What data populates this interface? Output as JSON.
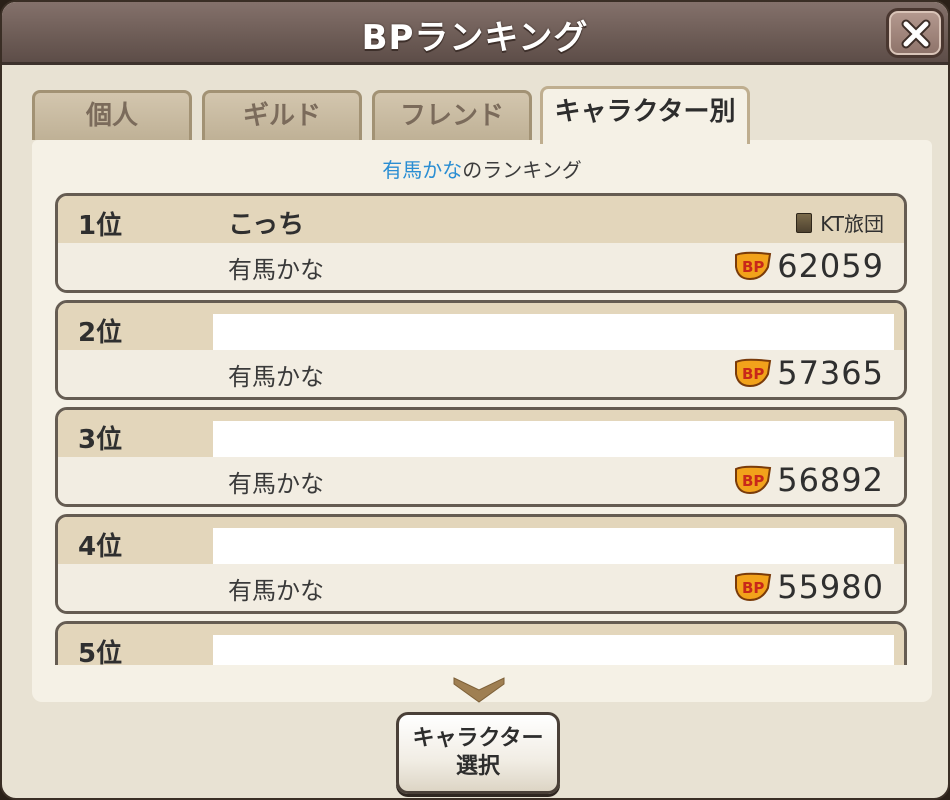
{
  "header": {
    "title": "BPランキング",
    "close_icon": "close-x-icon"
  },
  "tabs": [
    {
      "label": "個人",
      "active": false
    },
    {
      "label": "ギルド",
      "active": false
    },
    {
      "label": "フレンド",
      "active": false
    },
    {
      "label": "キャラクター別",
      "active": true
    }
  ],
  "subtitle": {
    "character": "有馬かな",
    "suffix": "のランキング"
  },
  "entries": [
    {
      "rank": "1位",
      "player": "こっち",
      "guild": "KT旅団",
      "character": "有馬かな",
      "score": "62059"
    },
    {
      "rank": "2位",
      "player": "",
      "guild": "",
      "character": "有馬かな",
      "score": "57365"
    },
    {
      "rank": "3位",
      "player": "",
      "guild": "",
      "character": "有馬かな",
      "score": "56892"
    },
    {
      "rank": "4位",
      "player": "",
      "guild": "",
      "character": "有馬かな",
      "score": "55980"
    },
    {
      "rank": "5位",
      "player": "",
      "guild": "",
      "character": "",
      "score": ""
    }
  ],
  "bp_badge": "BP",
  "select_button": {
    "line1": "キャラクター",
    "line2": "選択"
  },
  "colors": {
    "accent_name": "#2a8ed3",
    "header_bg": "#6e5d57",
    "panel_bg": "#f5f1e6"
  }
}
